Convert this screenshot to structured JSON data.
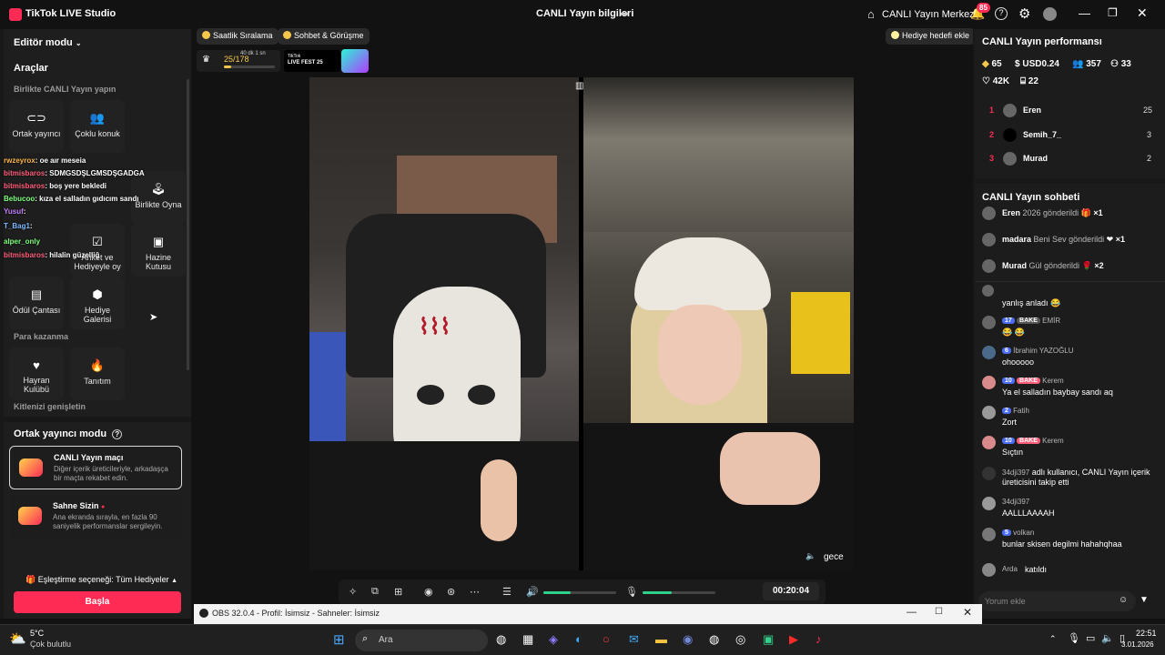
{
  "titlebar": {
    "app_name": "TikTok LIVE Studio",
    "center_title": "CANLI Yayın bilgileri",
    "home_label": "CANLI Yayın Merkezi",
    "notif_count": "85"
  },
  "left": {
    "editor_mode": "Editör modu",
    "tools_title": "Araçlar",
    "section_together": "Birlikte CANLI Yayın yapın",
    "tool_cohost": "Ortak yayıncı",
    "tool_multi_guest": "Çoklu konuk",
    "tool_play_together": "Birlikte Oyna",
    "tool_poll": "Anket ve Hediyeyle oy",
    "tool_treasure": "Hazine Kutusu",
    "tool_gift_bag": "Ödül Çantası",
    "tool_gift_gallery": "Hediye Galerisi",
    "section_earn": "Para kazanma",
    "tool_fan_club": "Hayran Kulübü",
    "tool_promo": "Tanıtım",
    "section_expand": "Kitlenizi genişletin",
    "cohost_mode": "Ortak yayıncı modu",
    "match_title": "CANLI Yayın maçı",
    "match_desc": "Diğer içerik üreticileriyle, arkadaşça bir maçta rekabet edin.",
    "stage_title": "Sahne Sizin",
    "stage_desc": "Ana ekranda sırayla, en fazla 90 saniyelik performanslar sergileyin.",
    "matching_pref": "Eşleştirme seçeneği: Tüm Hediyeler",
    "start": "Başla"
  },
  "overlay_chat": [
    {
      "user": "rwzeyrox",
      "msg": ": oe aır meseia",
      "color": "#ffb84d"
    },
    {
      "user": "bitmisbaros",
      "msg": ": SDMGSDŞLGMSDŞGADGA",
      "color": "#ff5e7a"
    },
    {
      "user": "bitmisbaros",
      "msg": ": boş yere bekledi",
      "color": "#ff5e7a"
    },
    {
      "user": "Bebucoo",
      "msg": ": kıza el salladın gıdıcım sandı",
      "color": "#7dff7d"
    },
    {
      "user": "Yusuf",
      "msg": ":",
      "color": "#c47dff"
    },
    {
      "user": "T_Bag1",
      "msg": ":",
      "color": "#7db8ff"
    },
    {
      "user": "alper_only",
      "msg": "",
      "color": "#7dff7d"
    },
    {
      "user": "bitmisbaros",
      "msg": ": hilalin güzelliğ",
      "color": "#ff5e7a"
    }
  ],
  "center": {
    "chip_hourly": "Saatlik Sıralama",
    "chip_chat": "Sohbet & Görüşme",
    "gift_goal": "Hediye hedefi ekle",
    "progress": "25/178",
    "progress_fraction": 0.14,
    "progress_time": "40 dk 1 sn",
    "livefest_top": "TikTok",
    "livefest": "LIVE FEST 25",
    "cam_label": "gece",
    "timer": "00:20:04",
    "volume_fraction": 0.38,
    "mic_fraction": 0.4
  },
  "right": {
    "perf_title": "CANLI Yayın performansı",
    "coins": "65",
    "usd": "USD0.24",
    "viewers": "357",
    "new_followers": "33",
    "likes": "42K",
    "gifters": "22",
    "ranking": [
      {
        "rank": "1",
        "name": "Eren",
        "value": "25"
      },
      {
        "rank": "2",
        "name": "Semih_7_",
        "value": "3"
      },
      {
        "rank": "3",
        "name": "Murad",
        "value": "2"
      }
    ],
    "chat_title": "CANLI Yayın sohbeti",
    "gifts": [
      {
        "name": "Eren",
        "text": "2026 gönderildi",
        "mult": "×1"
      },
      {
        "name": "madara",
        "text": "Beni Sev gönderildi",
        "mult": "×1"
      },
      {
        "name": "Murad",
        "text": "Gül gönderildi",
        "mult": "×2"
      }
    ],
    "messages": [
      {
        "name": "",
        "badge": "",
        "msg": "yanlış anladı 😂"
      },
      {
        "name": "EMİR",
        "badge": "17",
        "msg": "😂 😂"
      },
      {
        "name": "İbrahim YAZOĞLU",
        "badge": "6",
        "msg": "ohooooo"
      },
      {
        "name": "Kerem",
        "badge": "10",
        "msg": "Ya el salladın baybay sandı aq"
      },
      {
        "name": "Fatih",
        "badge": "2",
        "msg": "Zort"
      },
      {
        "name": "Kerem",
        "badge": "10",
        "msg": "Sıçtın"
      },
      {
        "name": "34dji397",
        "badge": "",
        "msg": "adlı kullanıcı, CANLI Yayın içerik üreticisini takip etti"
      },
      {
        "name": "34dji397",
        "badge": "",
        "msg": "AALLLAAAAH"
      },
      {
        "name": "volkan",
        "badge": "5",
        "msg": "bunlar skisen degilmi hahahqhaa"
      },
      {
        "name": "Arda",
        "badge": "",
        "msg": "katıldı"
      }
    ],
    "bake": "BAKE",
    "comment_placeholder": "Yorum ekle"
  },
  "obs": {
    "title": "OBS 32.0.4 - Profil: İsimsiz - Sahneler: İsimsiz"
  },
  "taskbar": {
    "weather_temp": "5°C",
    "weather_desc": "Çok bulutlu",
    "search": "Ara",
    "time": "22:51",
    "date": "3.01.2026"
  },
  "colors": {
    "accent": "#fe2c55",
    "panel": "#181818",
    "progress": "#f5c84b",
    "volume": "#2fd18a"
  }
}
